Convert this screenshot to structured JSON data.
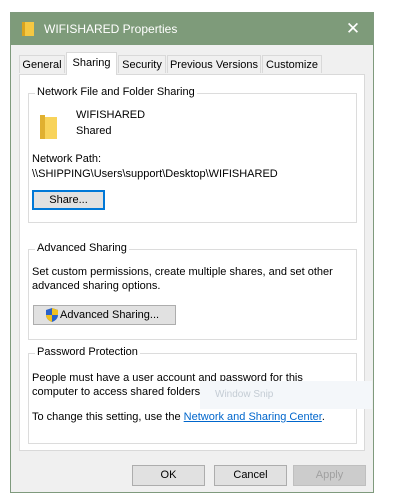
{
  "window": {
    "title": "WIFISHARED Properties",
    "close_glyph": "✕",
    "titlebar_color": "#7e9b7a"
  },
  "tabs": [
    {
      "label": "General"
    },
    {
      "label": "Sharing",
      "active": true
    },
    {
      "label": "Security"
    },
    {
      "label": "Previous Versions"
    },
    {
      "label": "Customize"
    }
  ],
  "network_sharing": {
    "title": "Network File and Folder Sharing",
    "folder_icon": "folder-icon",
    "folder_name": "WIFISHARED",
    "folder_status": "Shared",
    "path_label": "Network Path:",
    "path_value": "\\\\SHIPPING\\Users\\support\\Desktop\\WIFISHARED",
    "share_button": "Share..."
  },
  "advanced_sharing": {
    "title": "Advanced Sharing",
    "description_line1": "Set custom permissions, create multiple shares, and set other",
    "description_line2": "advanced sharing options.",
    "button_label": "Advanced Sharing...",
    "button_icon": "uac-shield-icon"
  },
  "password_protection": {
    "title": "Password Protection",
    "description_line1": "People must have a user account and password for this",
    "description_line2": "computer to access shared folders.",
    "change_prefix": "To change this setting, use the ",
    "link_text": "Network and Sharing Center",
    "change_suffix": "."
  },
  "overlay": {
    "ghost_label": "Window Snip"
  },
  "footer": {
    "ok": "OK",
    "cancel": "Cancel",
    "apply": "Apply"
  },
  "colors": {
    "accent_focus": "#0078d7",
    "link": "#0066cc",
    "folder_yellow": "#f5c842"
  }
}
